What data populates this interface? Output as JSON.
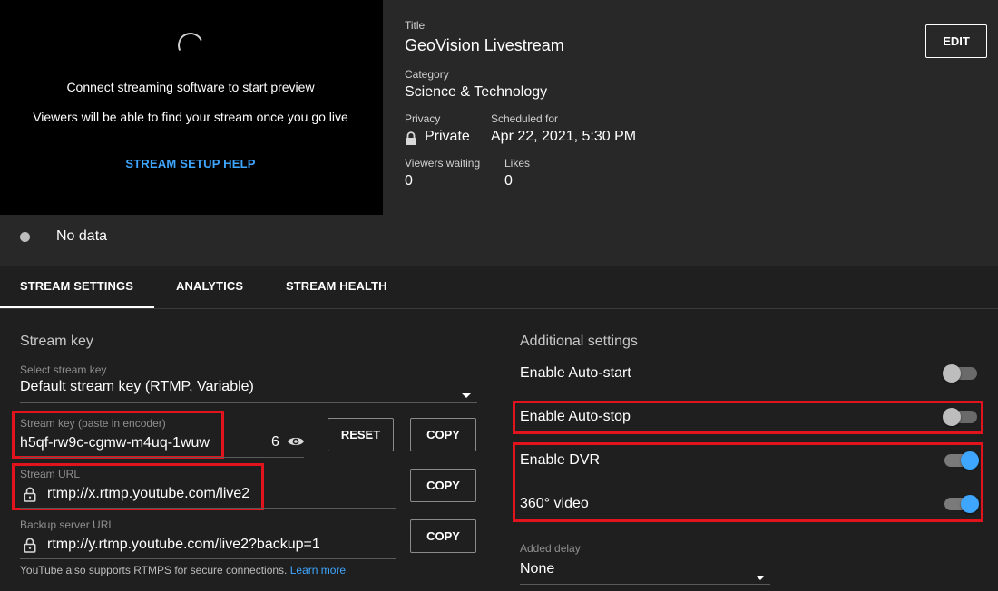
{
  "preview": {
    "message": "Connect streaming software to start preview",
    "subtext": "Viewers will be able to find your stream once you go live",
    "help_link": "STREAM SETUP HELP"
  },
  "details": {
    "title_label": "Title",
    "title": "GeoVision Livestream",
    "category_label": "Category",
    "category": "Science & Technology",
    "privacy_label": "Privacy",
    "privacy": "Private",
    "scheduled_label": "Scheduled for",
    "scheduled": "Apr 22, 2021, 5:30 PM",
    "viewers_label": "Viewers waiting",
    "viewers": "0",
    "likes_label": "Likes",
    "likes": "0",
    "edit_label": "EDIT"
  },
  "status": {
    "text": "No data"
  },
  "tabs": [
    {
      "label": "STREAM SETTINGS",
      "active": true
    },
    {
      "label": "ANALYTICS"
    },
    {
      "label": "STREAM HEALTH"
    }
  ],
  "stream_key": {
    "section_title": "Stream key",
    "select_label": "Select stream key",
    "select_value": "Default stream key (RTMP, Variable)",
    "key_label": "Stream key (paste in encoder)",
    "key_value": "h5qf-rw9c-cgmw-m4uq-1wuw",
    "key_suffix": "6",
    "reset_label": "RESET",
    "copy_label": "COPY",
    "url_label": "Stream URL",
    "url_value": "rtmp://x.rtmp.youtube.com/live2",
    "backup_label": "Backup server URL",
    "backup_value": "rtmp://y.rtmp.youtube.com/live2?backup=1",
    "note": "YouTube also supports RTMPS for secure connections.",
    "learn_more": "Learn more"
  },
  "additional": {
    "section_title": "Additional settings",
    "auto_start": {
      "label": "Enable Auto-start",
      "on": false
    },
    "auto_stop": {
      "label": "Enable Auto-stop",
      "on": false
    },
    "dvr": {
      "label": "Enable DVR",
      "on": true
    },
    "video360": {
      "label": "360° video",
      "on": true
    },
    "delay_label": "Added delay",
    "delay_value": "None"
  },
  "colors": {
    "accent": "#3ea6ff",
    "highlight": "#e1141e",
    "background": "#282828",
    "panel": "#1f1f1f"
  },
  "icons": [
    "spinner-icon",
    "lock-icon",
    "eye-icon",
    "dropdown-arrow-icon"
  ]
}
